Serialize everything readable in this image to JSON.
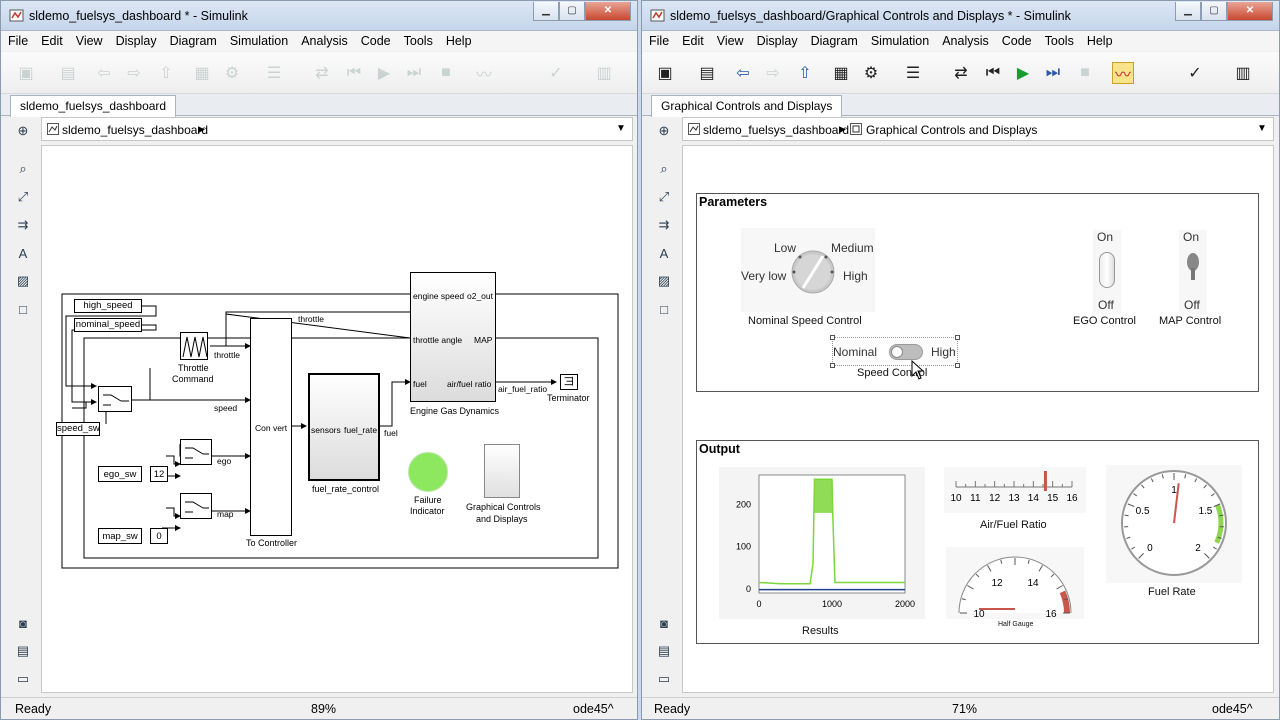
{
  "left_window": {
    "title": "sldemo_fuelsys_dashboard * - Simulink",
    "menu": [
      "File",
      "Edit",
      "View",
      "Display",
      "Diagram",
      "Simulation",
      "Analysis",
      "Code",
      "Tools",
      "Help"
    ],
    "tab": "sldemo_fuelsys_dashboard",
    "breadcrumb": [
      "sldemo_fuelsys_dashboard"
    ],
    "status": {
      "ready": "Ready",
      "zoom": "89%",
      "solver": "ode45^"
    },
    "blocks": {
      "high_speed": "high_speed",
      "nominal_speed": "nominal_speed",
      "speed_sw": "speed_sw",
      "ego_sw": "ego_sw",
      "ego_const": "12",
      "map_sw": "map_sw",
      "map_const": "0",
      "throttle_cmd_1": "Throttle",
      "throttle_cmd_2": "Command",
      "sig_throttle_a": "throttle",
      "sig_throttle_b": "throttle",
      "sig_speed": "speed",
      "sig_ego": "ego",
      "sig_map": "map",
      "convert": "Con vert",
      "to_controller": "To Controller",
      "fuel_ctl_sensors": "sensors",
      "fuel_ctl_rate": "fuel_rate",
      "fuel_ctl_name": "fuel_rate_control",
      "sig_fuel": "fuel",
      "engine_in_speed": "engine speed",
      "engine_in_throttle": "throttle angle",
      "engine_in_fuel": "fuel",
      "engine_out_o2": "o2_out",
      "engine_out_map": "MAP",
      "engine_out_afr": "air/fuel ratio",
      "engine_name": "Engine Gas Dynamics",
      "sig_afr": "air_fuel_ratio",
      "terminator": "Terminator",
      "failure_1": "Failure",
      "failure_2": "Indicator",
      "gcd_1": "Graphical Controls",
      "gcd_2": "and Displays"
    }
  },
  "right_window": {
    "title": "sldemo_fuelsys_dashboard/Graphical Controls and Displays * - Simulink",
    "menu": [
      "File",
      "Edit",
      "View",
      "Display",
      "Diagram",
      "Simulation",
      "Analysis",
      "Code",
      "Tools",
      "Help"
    ],
    "tab": "Graphical Controls and Displays",
    "breadcrumb": [
      "sldemo_fuelsys_dashboard",
      "Graphical Controls and Displays"
    ],
    "status": {
      "ready": "Ready",
      "zoom": "71%",
      "solver": "ode45^"
    },
    "parameters": {
      "heading": "Parameters",
      "knob": {
        "low": "Low",
        "medium": "Medium",
        "very_low": "Very low",
        "high": "High",
        "caption": "Nominal Speed Control"
      },
      "ego": {
        "on": "On",
        "off": "Off",
        "caption": "EGO Control"
      },
      "map": {
        "on": "On",
        "off": "Off",
        "caption": "MAP Control"
      },
      "speed": {
        "left": "Nominal",
        "right": "High",
        "caption": "Speed Control"
      }
    },
    "output": {
      "heading": "Output",
      "afr": {
        "ticks": [
          "10",
          "11",
          "12",
          "13",
          "14",
          "15",
          "16"
        ],
        "caption": "Air/Fuel Ratio",
        "value": 14.6
      },
      "half_gauge": {
        "ticks": [
          "10",
          "12",
          "14",
          "16"
        ],
        "caption": "Half Gauge",
        "value": 10
      },
      "fuel_rate": {
        "ticks": [
          "0",
          "0.5",
          "1",
          "1.5",
          "2"
        ],
        "caption": "Fuel Rate",
        "value": 1.05
      },
      "results_caption": "Results"
    }
  },
  "chart_data": {
    "type": "line",
    "title": "",
    "xlabel": "",
    "ylabel": "",
    "xlim": [
      0,
      2000
    ],
    "ylim": [
      -10,
      270
    ],
    "xticks": [
      "0",
      "1000",
      "2000"
    ],
    "yticks": [
      "0",
      "100",
      "200"
    ],
    "series": [
      {
        "color": "#7ed63a",
        "x": [
          0,
          300,
          700,
          740,
          760,
          1000,
          1010,
          1040,
          2000
        ],
        "y": [
          15,
          12,
          12,
          60,
          260,
          260,
          180,
          15,
          15
        ]
      },
      {
        "color": "#1f3f8a",
        "x": [
          0,
          2000
        ],
        "y": [
          -2,
          -2
        ]
      }
    ]
  }
}
